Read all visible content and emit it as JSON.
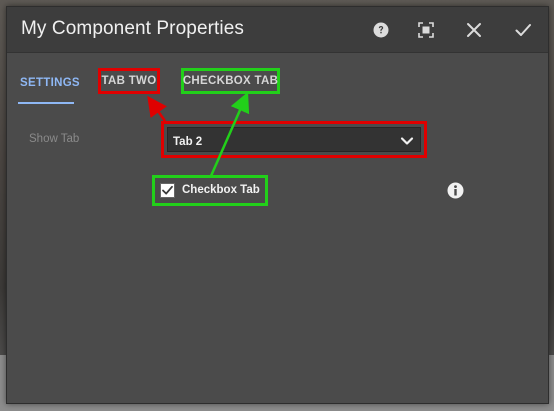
{
  "dialog": {
    "title": "My Component Properties",
    "icons": {
      "help": "help-circle-icon",
      "fullscreen": "fullscreen-icon",
      "close": "close-icon",
      "done": "checkmark-icon",
      "info": "info-icon",
      "dropdown": "chevron-down-icon"
    }
  },
  "tabs": [
    {
      "label": "SETTINGS",
      "active": true
    },
    {
      "label": "TAB TWO",
      "active": false
    },
    {
      "label": "CHECKBOX TAB",
      "active": false
    }
  ],
  "form": {
    "show_tab_label": "Show Tab",
    "show_tab_value": "Tab 2",
    "checkbox_label": "Checkbox Tab",
    "checkbox_checked": true
  },
  "annotations": {
    "red": "#e00000",
    "green": "#22d01a"
  },
  "colors": {
    "accent_blue": "#8fb8f5",
    "dialog_bg": "#4b4b4b",
    "header_bg": "#3d3d3d"
  }
}
